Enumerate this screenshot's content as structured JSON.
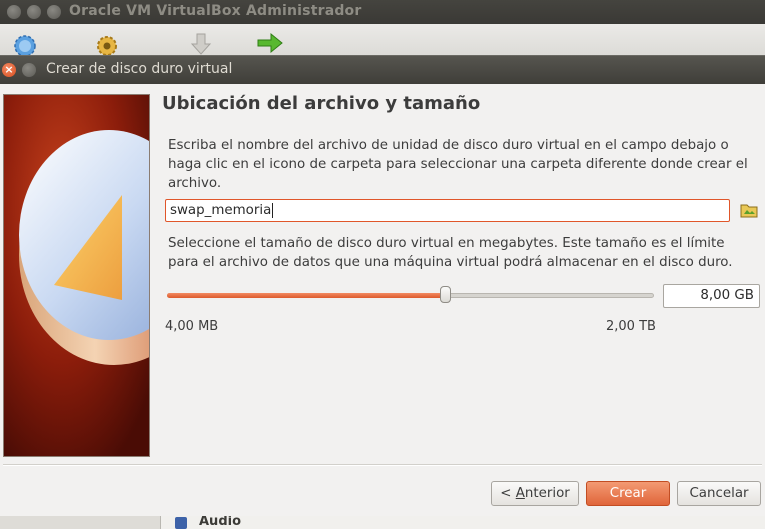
{
  "main_window": {
    "title": "Oracle VM VirtualBox Administrador",
    "toolbar_icons": [
      "new-machine-icon",
      "settings-icon",
      "discard-icon",
      "start-icon"
    ],
    "details_section": "Audio"
  },
  "dialog": {
    "title": "Crear de disco duro virtual",
    "heading": "Ubicación del archivo y tamaño",
    "file_instructions": "Escriba el nombre del archivo de unidad de disco duro virtual en el campo debajo o haga clic en el icono de carpeta para seleccionar una carpeta diferente donde crear el archivo.",
    "file_name": "swap_memoria",
    "size_instructions": "Seleccione el tamaño de disco duro virtual en megabytes. Este tamaño es el límite para el archivo de datos que una máquina virtual podrá almacenar en el disco duro.",
    "size_value": "8,00 GB",
    "slider_fraction": 0.57,
    "range_min": "4,00 MB",
    "range_max": "2,00 TB",
    "buttons": {
      "previous_prefix": "< ",
      "previous_accel": "A",
      "previous_rest": "nterior",
      "create": "Crear",
      "cancel": "Cancelar"
    }
  },
  "colors": {
    "accent": "#dd5a2c",
    "titlebar": "#3f3e39",
    "dialog_bg": "#f2f1f0"
  }
}
